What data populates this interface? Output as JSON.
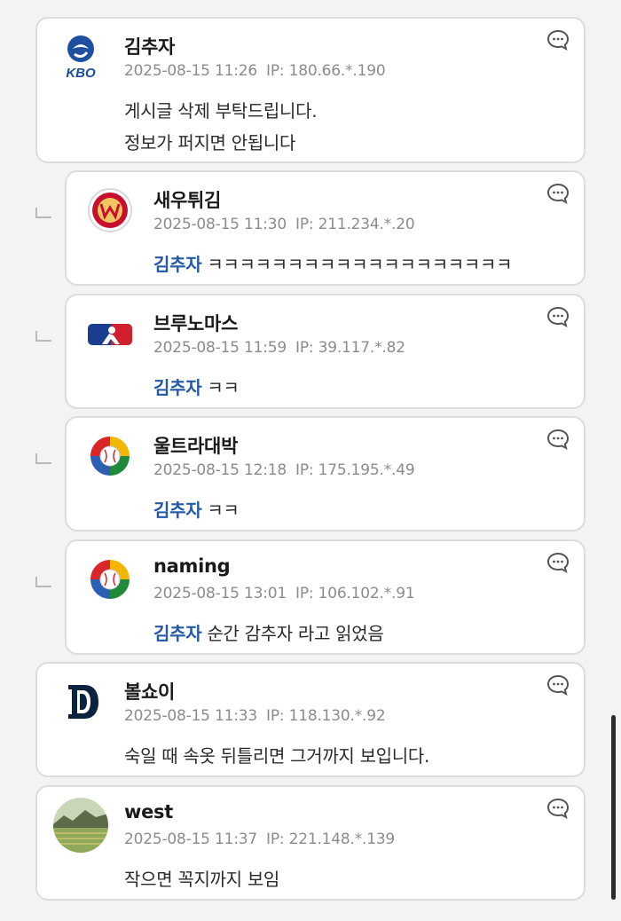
{
  "comments": [
    {
      "avatar": "kbo-logo",
      "avatar_text": "KBO",
      "nickname": "김추자",
      "date": "2025-08-15 11:26",
      "ip": "IP: 180.66.*.190",
      "lines": [
        "게시글 삭제 부탁드립니다.",
        "정보가 퍼지면 안됩니다"
      ]
    },
    {
      "avatar": "ssg-landers-logo",
      "nickname": "새우튀김",
      "date": "2025-08-15 11:30",
      "ip": "IP: 211.234.*.20",
      "mention": "김추자",
      "text": "ㅋㅋㅋㅋㅋㅋㅋㅋㅋㅋㅋㅋㅋㅋㅋㅋㅋㅋㅋ"
    },
    {
      "avatar": "mlb-logo",
      "nickname": "브루노마스",
      "date": "2025-08-15 11:59",
      "ip": "IP: 39.117.*.82",
      "mention": "김추자",
      "text": "ㅋㅋ"
    },
    {
      "avatar": "wbc-logo",
      "nickname": "울트라대박",
      "date": "2025-08-15 12:18",
      "ip": "IP: 175.195.*.49",
      "mention": "김추자",
      "text": "ㅋㅋ"
    },
    {
      "avatar": "wbc-logo",
      "nickname": "naming",
      "date": "2025-08-15 13:01",
      "ip": "IP: 106.102.*.91",
      "mention": "김추자",
      "text": "순간 감추자 라고 읽었음"
    },
    {
      "avatar": "tigers-logo",
      "nickname": "볼쇼이",
      "date": "2025-08-15 11:33",
      "ip": "IP: 118.130.*.92",
      "text": "숙일 때 속옷 뒤틀리면 그거까지 보입니다."
    },
    {
      "avatar": "landscape-photo",
      "nickname": "west",
      "date": "2025-08-15 11:37",
      "ip": "IP: 221.148.*.139",
      "text": "작으면 꼭지까지 보임"
    }
  ],
  "icons": {
    "reply": "speech-bubble-icon",
    "reply_indent": "reply-indent-icon"
  },
  "colors": {
    "mention": "#2459a8",
    "meta": "#8c8c8c",
    "card_border": "#dcdcdc",
    "background": "#f3f3f3"
  }
}
